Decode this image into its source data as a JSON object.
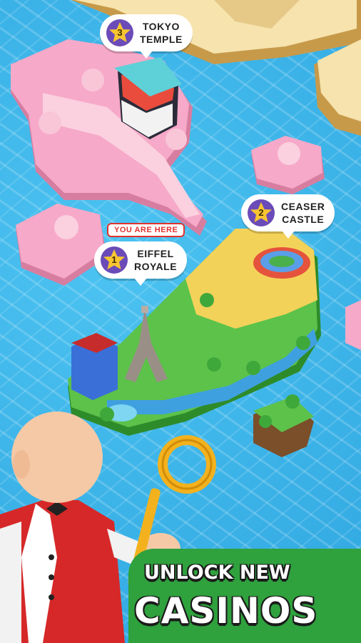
{
  "locations": [
    {
      "number": "3",
      "name": "TOKYO\nTEMPLE"
    },
    {
      "number": "2",
      "name": "CEASER\nCASTLE"
    },
    {
      "number": "1",
      "name": "EIFFEL\nROYALE"
    }
  ],
  "you_are_here": "YOU ARE HERE",
  "headline": {
    "line1": "UNLOCK NEW",
    "line2": "CASINOS"
  },
  "colors": {
    "water": "#3fb6ea",
    "pink_island": "#f6a9c8",
    "green_island": "#5cc24a",
    "sand": "#f3d25a",
    "banner": "#2fa13d",
    "star": "#f7c531",
    "marker_red": "#e0322f"
  }
}
